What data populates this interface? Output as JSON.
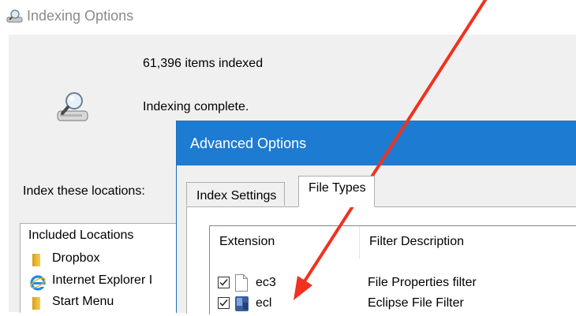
{
  "window": {
    "title": "Indexing Options",
    "title_icon": "indexing-options-icon"
  },
  "main": {
    "items_indexed": "61,396 items indexed",
    "status": "Indexing complete.",
    "status_icon": "indexing-drive-icon",
    "index_locations_label": "Index these locations:"
  },
  "locations": {
    "header": "Included Locations",
    "items": [
      {
        "label": "Dropbox",
        "icon": "folder-icon"
      },
      {
        "label": "Internet Explorer I",
        "icon": "internet-explorer-icon"
      },
      {
        "label": "Start Menu",
        "icon": "folder-icon"
      }
    ]
  },
  "dialog": {
    "title": "Advanced Options",
    "tabs": [
      {
        "label": "Index Settings",
        "active": false
      },
      {
        "label": "File Types",
        "active": true
      }
    ],
    "list": {
      "columns": [
        "Extension",
        "Filter Description"
      ],
      "rows": [
        {
          "checked": true,
          "extension": "ec3",
          "icon": "blank-file-icon",
          "filter": "File Properties filter"
        },
        {
          "checked": true,
          "extension": "ecl",
          "icon": "eclipse-file-icon",
          "filter": "Eclipse File Filter"
        }
      ]
    }
  },
  "annotation": {
    "color": "#f0321e",
    "icon": "red-arrow-annotation"
  },
  "colors": {
    "dialog_titlebar": "#1e7bd2",
    "window_background": "#f0f0f0",
    "annotation_arrow": "#f0321e"
  }
}
